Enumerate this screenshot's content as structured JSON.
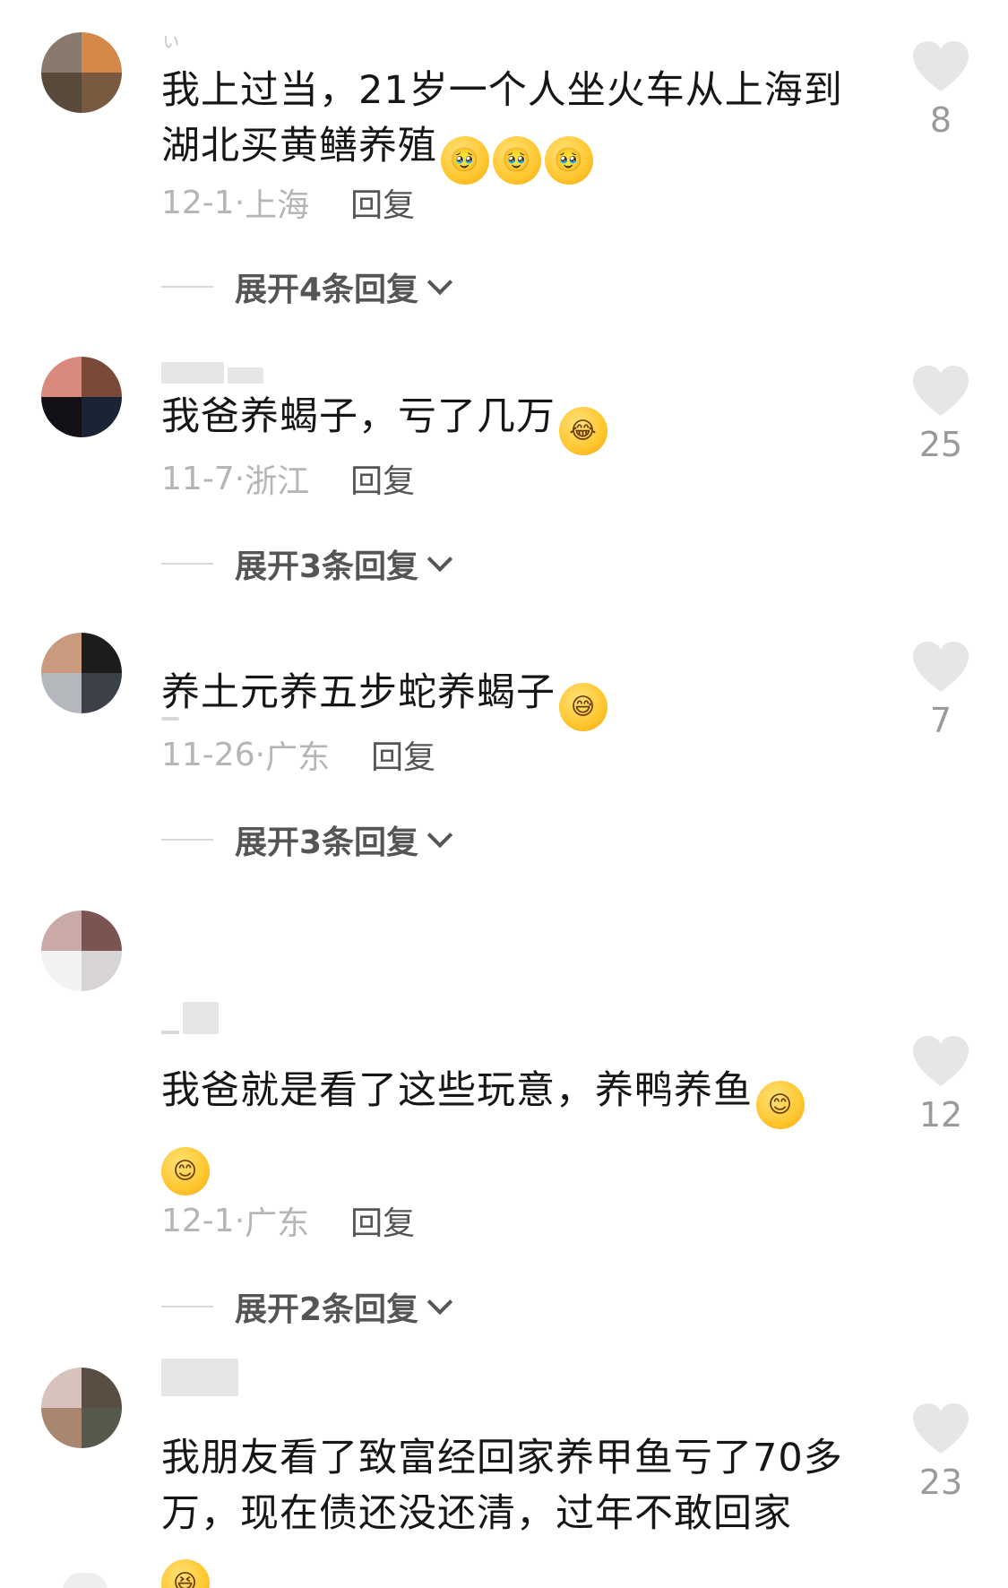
{
  "comments": [
    {
      "username": "ぃ",
      "text": "我上过当，21岁一个人坐火车从上海到湖北买黄鳝养殖",
      "emojis": [
        "crying-pleading-emoji",
        "crying-pleading-emoji",
        "crying-pleading-emoji"
      ],
      "date": "12-1",
      "location": "上海",
      "reply_label": "回复",
      "expand_label": "展开4条回复",
      "likes": "8",
      "avatar_colors": [
        "#8a7a6e",
        "#d4884a",
        "#5a4a3c",
        "#7a5a3e"
      ]
    },
    {
      "username": "",
      "text": "我爸养蝎子，亏了几万",
      "emojis": [
        "laughing-crying-emoji"
      ],
      "date": "11-7",
      "location": "浙江",
      "reply_label": "回复",
      "expand_label": "展开3条回复",
      "likes": "25",
      "avatar_colors": [
        "#d98a7c",
        "#7a4a38",
        "#141018",
        "#1a2436"
      ]
    },
    {
      "username": "",
      "text": "养土元养五步蛇养蝎子",
      "emojis": [
        "grinning-sweat-emoji"
      ],
      "date": "11-26",
      "location": "广东",
      "reply_label": "回复",
      "expand_label": "展开3条回复",
      "likes": "7",
      "avatar_colors": [
        "#c99a7e",
        "#1c1c1c",
        "#b4b8bc",
        "#3c4048"
      ]
    },
    {
      "username": "",
      "text": "我爸就是看了这些玩意，养鸭养鱼",
      "emojis": [
        "smiling-emoji",
        "smiling-emoji"
      ],
      "date": "12-1",
      "location": "广东",
      "reply_label": "回复",
      "expand_label": "展开2条回复",
      "likes": "12",
      "avatar_colors": [
        "#c9aaa6",
        "#7a5450",
        "#f2f2f2",
        "#d8d4d4"
      ]
    },
    {
      "username": "",
      "text": "我朋友看了致富经回家养甲鱼亏了70多万，现在债还没还清，过年不敢回家",
      "emojis": [
        "laughing-emoji"
      ],
      "likes": "23",
      "avatar_colors": [
        "#d8c2bc",
        "#5a4e42",
        "#a88670",
        "#565a4c"
      ]
    }
  ],
  "colors": {
    "text": "#161616",
    "meta": "#b5b5b5",
    "reply": "#555555",
    "heart": "#e6e6e6",
    "like_count": "#9a9a9a"
  }
}
